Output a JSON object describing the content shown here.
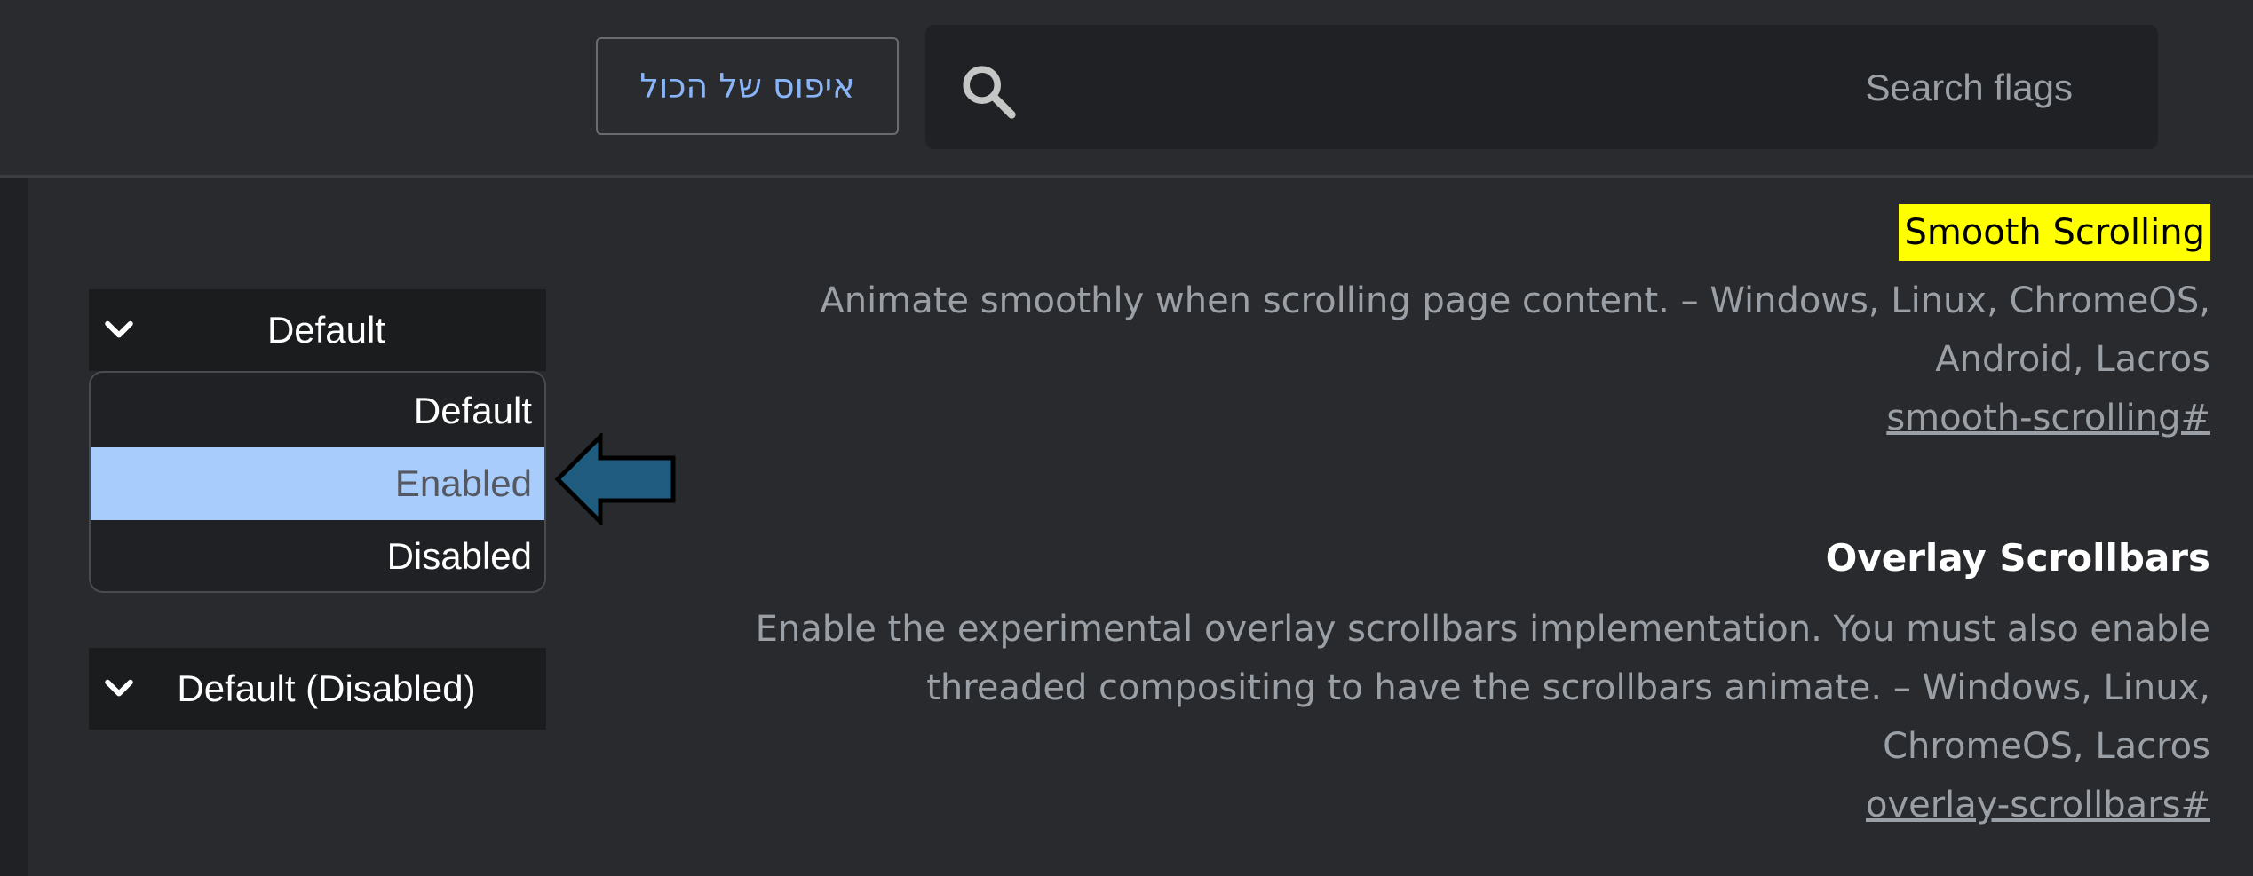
{
  "header": {
    "reset_label": "איפוס של הכול",
    "search_placeholder": "Search flags",
    "search_value": ""
  },
  "flags": [
    {
      "title": "Smooth Scrolling",
      "description_lines": [
        "Animate smoothly when scrolling page content. – Windows, Linux, ChromeOS,",
        "Android, Lacros"
      ],
      "link": "smooth-scrolling#",
      "select_value": "Default",
      "dropdown_open": true,
      "options": [
        "Default",
        "Enabled",
        "Disabled"
      ],
      "highlighted_option": "Enabled"
    },
    {
      "title": "Overlay Scrollbars",
      "description_lines": [
        "Enable the experimental overlay scrollbars implementation. You must also enable",
        "threaded compositing to have the scrollbars animate. – Windows, Linux,",
        "ChromeOS, Lacros"
      ],
      "link": "overlay-scrollbars#",
      "select_value": "Default (Disabled)"
    }
  ],
  "colors": {
    "background": "#292a2d",
    "search_background": "#202124",
    "highlight_yellow": "#ffff00",
    "selected_option": "#a8cdfd",
    "link_blue": "#8ab4f8",
    "arrow_fill": "#1f5c80"
  },
  "icons": {
    "search": "search-icon",
    "chevron": "chevron-down-icon",
    "arrow": "left-arrow-icon"
  }
}
